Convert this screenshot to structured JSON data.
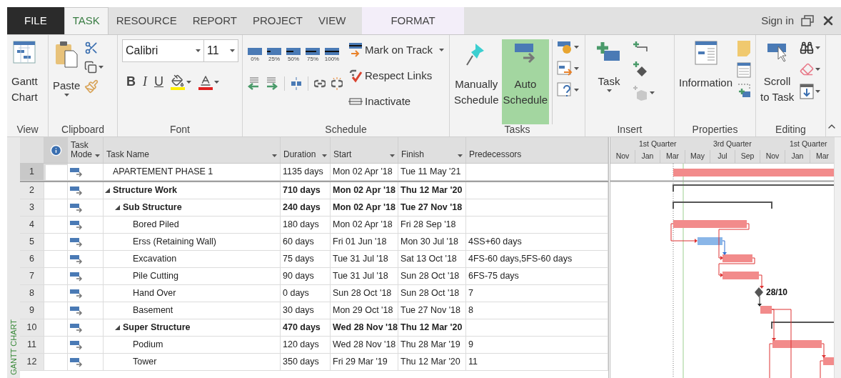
{
  "tabs": [
    {
      "label": "FILE",
      "kind": "file",
      "selected": false
    },
    {
      "label": "TASK",
      "kind": "tab",
      "selected": true
    },
    {
      "label": "RESOURCE",
      "kind": "tab",
      "selected": false
    },
    {
      "label": "REPORT",
      "kind": "tab",
      "selected": false
    },
    {
      "label": "PROJECT",
      "kind": "tab",
      "selected": false
    },
    {
      "label": "VIEW",
      "kind": "tab",
      "selected": false
    },
    {
      "label": "FORMAT",
      "kind": "contextual",
      "selected": false
    }
  ],
  "account": {
    "label": "Sign in"
  },
  "ribbon": {
    "view": {
      "title": "View",
      "button": [
        "Gantt",
        "Chart"
      ]
    },
    "clipboard": {
      "title": "Clipboard",
      "paste": "Paste"
    },
    "font": {
      "title": "Font",
      "family": "Calibri",
      "size": "11",
      "styles": [
        "B",
        "I",
        "U"
      ]
    },
    "schedule": {
      "title": "Schedule",
      "percents": [
        "0%",
        "25%",
        "50%",
        "75%",
        "100%"
      ],
      "commands": [
        {
          "label": "Mark on Track",
          "kind": "mark"
        },
        {
          "label": "Respect Links",
          "kind": "respect"
        },
        {
          "label": "Inactivate",
          "kind": "inactivate"
        }
      ]
    },
    "tasks": {
      "title": "Tasks",
      "modes": [
        {
          "label": [
            "Manually",
            "Schedule"
          ],
          "kind": "manual",
          "selected": false
        },
        {
          "label": [
            "Auto",
            "Schedule"
          ],
          "kind": "auto",
          "selected": true
        }
      ]
    },
    "insert": {
      "title": "Insert",
      "task": "Task"
    },
    "properties": {
      "title": "Properties",
      "information": "Information"
    },
    "editing": {
      "title": "Editing",
      "scroll": [
        "Scroll",
        "to Task"
      ]
    }
  },
  "view_bar": {
    "label": "GANTT CHART"
  },
  "table": {
    "columns": [
      {
        "label": "Task Mode",
        "filter": true
      },
      {
        "label": "Task Name",
        "filter": true
      },
      {
        "label": "Duration",
        "filter": true
      },
      {
        "label": "Start",
        "filter": true
      },
      {
        "label": "Finish",
        "filter": true
      },
      {
        "label": "Predecessors",
        "filter": false
      }
    ],
    "rows": [
      {
        "id": "1",
        "name": "APARTEMENT PHASE 1",
        "duration": "1135 days",
        "start": "Mon 02 Apr '18",
        "finish": "Tue 11 May '21",
        "selected": true
      },
      {
        "id": "2",
        "name": "Structure Work",
        "duration": "710 days",
        "start": "Mon 02 Apr '18",
        "finish": "Thu 12 Mar '20",
        "selected": false,
        "expanded": true,
        "children": [
          {
            "id": "3",
            "name": "Sub Structure",
            "duration": "240 days",
            "start": "Mon 02 Apr '18",
            "finish": "Tue 27 Nov '18",
            "selected": false,
            "expanded": true,
            "children": [
              {
                "id": "4",
                "name": "Bored Piled",
                "duration": "180 days",
                "start": "Mon 02 Apr '18",
                "finish": "Fri 28 Sep '18",
                "selected": false
              },
              {
                "id": "5",
                "name": "Erss (Retaining Wall)",
                "duration": "60 days",
                "start": "Fri 01 Jun '18",
                "finish": "Mon 30 Jul '18",
                "predecessors": "4SS+60 days",
                "selected": false
              },
              {
                "id": "6",
                "name": "Excavation",
                "duration": "75 days",
                "start": "Tue 31 Jul '18",
                "finish": "Sat 13 Oct '18",
                "predecessors": "4FS-60 days,5FS-60 days",
                "selected": false
              },
              {
                "id": "7",
                "name": "Pile Cutting",
                "duration": "90 days",
                "start": "Tue 31 Jul '18",
                "finish": "Sun 28 Oct '18",
                "predecessors": "6FS-75 days",
                "selected": false
              },
              {
                "id": "8",
                "name": "Hand Over",
                "duration": "0 days",
                "start": "Sun 28 Oct '18",
                "finish": "Sun 28 Oct '18",
                "predecessors": "7",
                "selected": false
              },
              {
                "id": "9",
                "name": "Basement",
                "duration": "30 days",
                "start": "Mon 29 Oct '18",
                "finish": "Tue 27 Nov '18",
                "predecessors": "8",
                "selected": false
              }
            ]
          },
          {
            "id": "10",
            "name": "Super Structure",
            "duration": "470 days",
            "start": "Wed 28 Nov '18",
            "finish": "Thu 12 Mar '20",
            "selected": false,
            "expanded": true,
            "children": [
              {
                "id": "11",
                "name": "Podium",
                "duration": "120 days",
                "start": "Wed 28 Nov '18",
                "finish": "Thu 28 Mar '19",
                "predecessors": "9",
                "selected": false
              },
              {
                "id": "12",
                "name": "Tower",
                "duration": "350 days",
                "start": "Fri 29 Mar '19",
                "finish": "Thu 12 Mar '20",
                "predecessors": "11",
                "selected": false
              }
            ]
          }
        ]
      }
    ]
  },
  "gantt": {
    "quarters": [
      "1st Quarter",
      "3rd Quarter",
      "1st Quarter"
    ],
    "months": [
      "Nov",
      "Jan",
      "Mar",
      "May",
      "Jul",
      "Sep",
      "Nov",
      "Jan",
      "Mar"
    ],
    "milestone_label": "28/10"
  }
}
